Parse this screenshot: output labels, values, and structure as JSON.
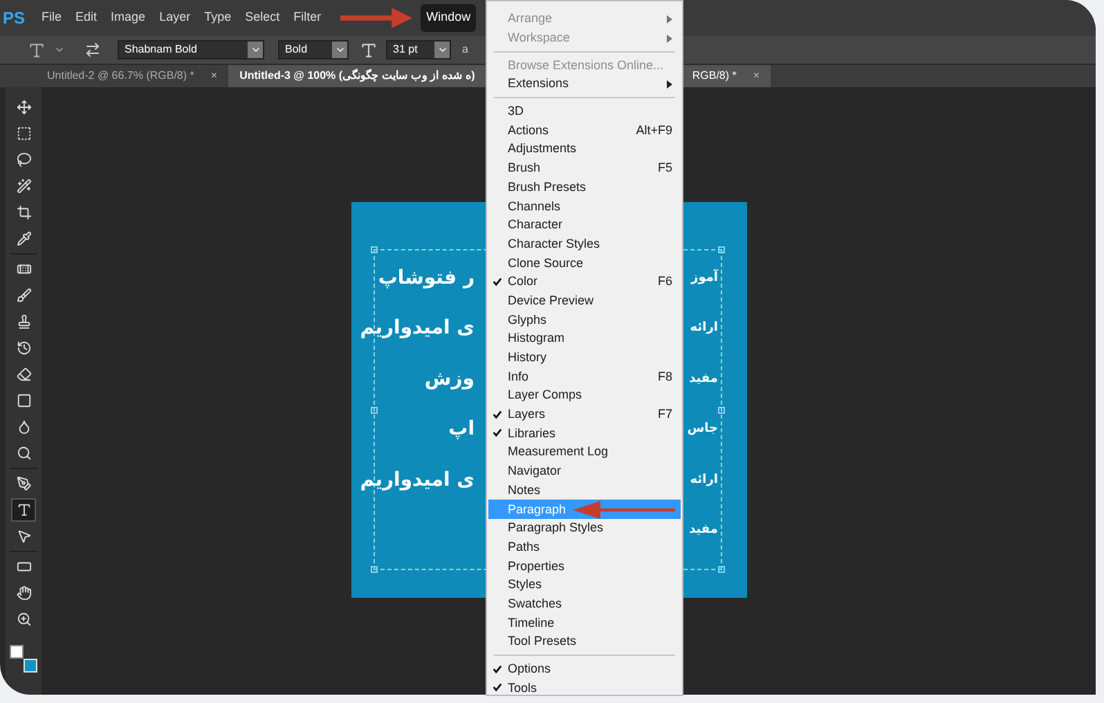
{
  "app_logo": "PS",
  "menubar": [
    {
      "label": "File",
      "selected": false
    },
    {
      "label": "Edit",
      "selected": false
    },
    {
      "label": "Image",
      "selected": false
    },
    {
      "label": "Layer",
      "selected": false
    },
    {
      "label": "Type",
      "selected": false
    },
    {
      "label": "Select",
      "selected": false
    },
    {
      "label": "Filter",
      "selected": false
    },
    {
      "label": "Window",
      "selected": true
    }
  ],
  "options_bar": {
    "font_family": "Shabnam Bold",
    "font_style": "Bold",
    "font_size": "31 pt",
    "cut_label": "a"
  },
  "tabs": [
    {
      "label": "Untitled-2 @ 66.7% (RGB/8) *",
      "close": "×",
      "selected": false
    },
    {
      "label": "Untitled-3 @ 100% (ه شده از وب سایت چگونگی)",
      "label_after_menu": "RGB/8) *",
      "close": "×",
      "selected": true
    }
  ],
  "tools": [
    {
      "selected": false
    },
    {
      "selected": false
    },
    {
      "selected": false
    },
    {
      "selected": false
    },
    {
      "selected": false
    },
    {
      "selected": false
    },
    {
      "selected": false
    },
    {
      "selected": false
    },
    {
      "selected": false
    },
    {
      "selected": false
    },
    {
      "selected": false
    },
    {
      "selected": false
    },
    {
      "selected": false
    },
    {
      "selected": false
    },
    {
      "selected": false
    },
    {
      "selected": true
    },
    {
      "selected": false
    },
    {
      "selected": false
    },
    {
      "selected": false
    },
    {
      "selected": false
    }
  ],
  "canvas_text": [
    {
      "left": "ر فتوشاپ",
      "right": "آموز"
    },
    {
      "left": "ی امیدواریم",
      "right": "ارائه"
    },
    {
      "left": "وزش",
      "right": "مفید"
    },
    {
      "left": "اپ",
      "right": "جاس"
    },
    {
      "left": "ی امیدواریم",
      "right": "ارائه"
    },
    {
      "right": "مفید"
    }
  ],
  "window_menu": [
    {
      "kind": "item",
      "label": "Arrange",
      "disabled": true,
      "submenu": true,
      "checked": false,
      "selected": false
    },
    {
      "kind": "item",
      "label": "Workspace",
      "disabled": true,
      "submenu": true,
      "checked": false,
      "selected": false
    },
    {
      "kind": "separator"
    },
    {
      "kind": "item",
      "label": "Browse Extensions Online...",
      "disabled": true,
      "submenu": false,
      "checked": false,
      "selected": false
    },
    {
      "kind": "item",
      "label": "Extensions",
      "disabled": false,
      "submenu": true,
      "checked": false,
      "selected": false
    },
    {
      "kind": "separator"
    },
    {
      "kind": "item",
      "label": "3D",
      "disabled": false,
      "submenu": false,
      "checked": false,
      "selected": false
    },
    {
      "kind": "item",
      "label": "Actions",
      "shortcut": "Alt+F9",
      "disabled": false,
      "submenu": false,
      "checked": false,
      "selected": false
    },
    {
      "kind": "item",
      "label": "Adjustments",
      "disabled": false,
      "submenu": false,
      "checked": false,
      "selected": false
    },
    {
      "kind": "item",
      "label": "Brush",
      "shortcut": "F5",
      "disabled": false,
      "submenu": false,
      "checked": false,
      "selected": false
    },
    {
      "kind": "item",
      "label": "Brush Presets",
      "disabled": false,
      "submenu": false,
      "checked": false,
      "selected": false
    },
    {
      "kind": "item",
      "label": "Channels",
      "disabled": false,
      "submenu": false,
      "checked": false,
      "selected": false
    },
    {
      "kind": "item",
      "label": "Character",
      "disabled": false,
      "submenu": false,
      "checked": false,
      "selected": false
    },
    {
      "kind": "item",
      "label": "Character Styles",
      "disabled": false,
      "submenu": false,
      "checked": false,
      "selected": false
    },
    {
      "kind": "item",
      "label": "Clone Source",
      "disabled": false,
      "submenu": false,
      "checked": false,
      "selected": false
    },
    {
      "kind": "item",
      "label": "Color",
      "shortcut": "F6",
      "disabled": false,
      "submenu": false,
      "checked": true,
      "selected": false
    },
    {
      "kind": "item",
      "label": "Device Preview",
      "disabled": false,
      "submenu": false,
      "checked": false,
      "selected": false
    },
    {
      "kind": "item",
      "label": "Glyphs",
      "disabled": false,
      "submenu": false,
      "checked": false,
      "selected": false
    },
    {
      "kind": "item",
      "label": "Histogram",
      "disabled": false,
      "submenu": false,
      "checked": false,
      "selected": false
    },
    {
      "kind": "item",
      "label": "History",
      "disabled": false,
      "submenu": false,
      "checked": false,
      "selected": false
    },
    {
      "kind": "item",
      "label": "Info",
      "shortcut": "F8",
      "disabled": false,
      "submenu": false,
      "checked": false,
      "selected": false
    },
    {
      "kind": "item",
      "label": "Layer Comps",
      "disabled": false,
      "submenu": false,
      "checked": false,
      "selected": false
    },
    {
      "kind": "item",
      "label": "Layers",
      "shortcut": "F7",
      "disabled": false,
      "submenu": false,
      "checked": true,
      "selected": false
    },
    {
      "kind": "item",
      "label": "Libraries",
      "disabled": false,
      "submenu": false,
      "checked": true,
      "selected": false
    },
    {
      "kind": "item",
      "label": "Measurement Log",
      "disabled": false,
      "submenu": false,
      "checked": false,
      "selected": false
    },
    {
      "kind": "item",
      "label": "Navigator",
      "disabled": false,
      "submenu": false,
      "checked": false,
      "selected": false
    },
    {
      "kind": "item",
      "label": "Notes",
      "disabled": false,
      "submenu": false,
      "checked": false,
      "selected": false
    },
    {
      "kind": "item",
      "label": "Paragraph",
      "disabled": false,
      "submenu": false,
      "checked": false,
      "selected": true
    },
    {
      "kind": "item",
      "label": "Paragraph Styles",
      "disabled": false,
      "submenu": false,
      "checked": false,
      "selected": false
    },
    {
      "kind": "item",
      "label": "Paths",
      "disabled": false,
      "submenu": false,
      "checked": false,
      "selected": false
    },
    {
      "kind": "item",
      "label": "Properties",
      "disabled": false,
      "submenu": false,
      "checked": false,
      "selected": false
    },
    {
      "kind": "item",
      "label": "Styles",
      "disabled": false,
      "submenu": false,
      "checked": false,
      "selected": false
    },
    {
      "kind": "item",
      "label": "Swatches",
      "disabled": false,
      "submenu": false,
      "checked": false,
      "selected": false
    },
    {
      "kind": "item",
      "label": "Timeline",
      "disabled": false,
      "submenu": false,
      "checked": false,
      "selected": false
    },
    {
      "kind": "item",
      "label": "Tool Presets",
      "disabled": false,
      "submenu": false,
      "checked": false,
      "selected": false
    },
    {
      "kind": "separator"
    },
    {
      "kind": "item",
      "label": "Options",
      "disabled": false,
      "submenu": false,
      "checked": true,
      "selected": false
    },
    {
      "kind": "item",
      "label": "Tools",
      "disabled": false,
      "submenu": false,
      "checked": true,
      "selected": false
    }
  ]
}
